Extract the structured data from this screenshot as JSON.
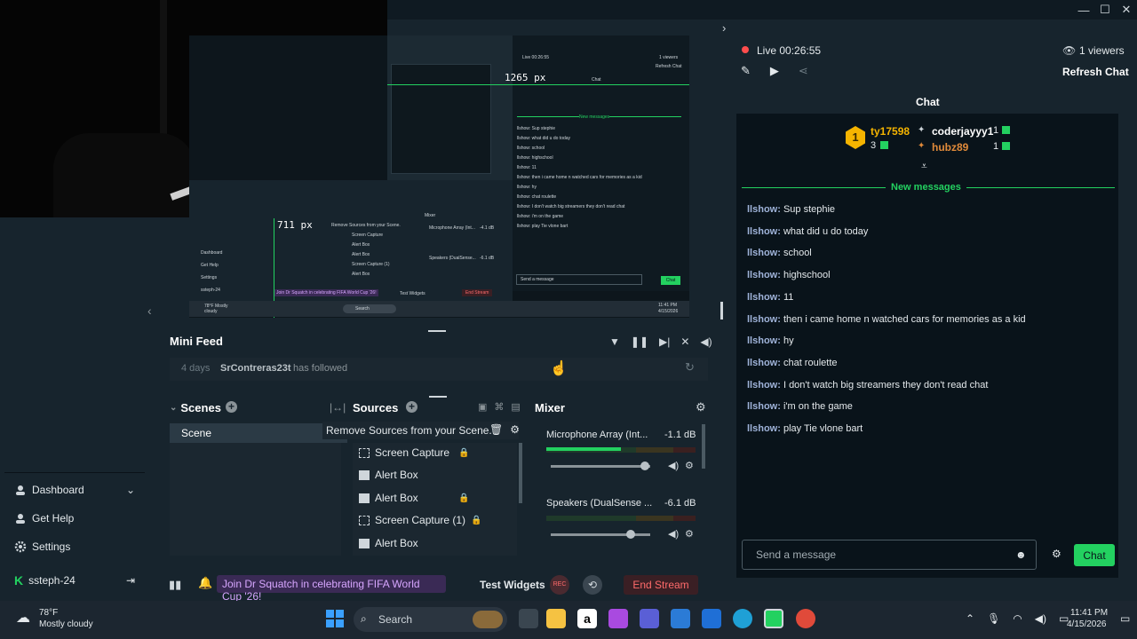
{
  "preview": {
    "width_label": "1265 px",
    "height_label": "711 px",
    "mini_text": {
      "live": "Live 00:26:55",
      "viewers": "1 viewers",
      "refresh": "Refresh Chat",
      "chat": "Chat",
      "new_messages": "New messages",
      "msgs": [
        "llshow: Sup stephie",
        "llshow: what did u do today",
        "llshow: school",
        "llshow: highschool",
        "llshow: 11",
        "llshow: then i came home n watched cars for memories as a kid",
        "llshow: hy",
        "llshow: chat roulette",
        "llshow: I don't watch big streamers they don't read chat",
        "llshow: i'm on the game",
        "llshow: play Tie vlone bart"
      ],
      "send": "Send a message",
      "chat_btn": "Chat",
      "mixer": "Mixer",
      "remove_sources": "Remove Sources from your Scene.",
      "src_items": [
        "Screen Capture",
        "Alert Box",
        "Alert Box",
        "Screen Capture (1)",
        "Alert Box"
      ],
      "mic": "Microphone Array (Int...",
      "mic_db": "-4.1 dB",
      "spk": "Speakers (DualSense...",
      "spk_db": "-6.1 dB",
      "nav": [
        "Dashboard",
        "Get Help",
        "Settings",
        "ssteph-24"
      ],
      "promo": "Join Dr Squatch in celebrating FIFA World Cup '26!",
      "test": "Test Widgets",
      "end": "End Stream",
      "weather": "78°F Mostly cloudy",
      "search": "Search",
      "time": "11:41 PM",
      "date": "4/15/2026"
    }
  },
  "left_nav": {
    "dashboard": "Dashboard",
    "get_help": "Get Help",
    "settings": "Settings",
    "user": "ssteph-24"
  },
  "minifeed": {
    "title": "Mini Feed",
    "time": "4 days",
    "user": "SrContreras23t",
    "action": "has followed"
  },
  "scenes": {
    "title": "Scenes",
    "items": [
      "Scene"
    ]
  },
  "sources": {
    "title": "Sources",
    "tooltip": "Remove Sources from your Scene.",
    "items": [
      "Screen Capture",
      "Alert Box",
      "Alert Box",
      "Screen Capture (1)",
      "Alert Box"
    ]
  },
  "mixer": {
    "title": "Mixer",
    "channels": [
      {
        "name": "Microphone Array (Int...",
        "db": "-1.1 dB",
        "level": 0.5,
        "volume": 0.95
      },
      {
        "name": "Speakers (DualSense ...",
        "db": "-6.1 dB",
        "level": 0.0,
        "volume": 0.8
      }
    ]
  },
  "bottombar": {
    "promo": "Join Dr Squatch in celebrating FIFA World Cup '26!",
    "test_widgets": "Test Widgets",
    "end_stream": "End Stream"
  },
  "chat": {
    "status": "Live 00:26:55",
    "viewers": "1 viewers",
    "refresh": "Refresh Chat",
    "title": "Chat",
    "top_user1": "ty17598",
    "top_user1_count": "3",
    "top_user2": "coderjayyy1",
    "top_user2_count": "1",
    "top_user3": "hubz89",
    "top_user3_count": "1",
    "rank": "1",
    "new_messages": "New messages",
    "messages": [
      {
        "user": "llshow:",
        "text": "Sup stephie"
      },
      {
        "user": "llshow:",
        "text": "what did u do today"
      },
      {
        "user": "llshow:",
        "text": "school"
      },
      {
        "user": "llshow:",
        "text": "highschool"
      },
      {
        "user": "llshow:",
        "text": "11"
      },
      {
        "user": "llshow:",
        "text": "then i came home n watched cars for memories as a kid"
      },
      {
        "user": "llshow:",
        "text": "hy"
      },
      {
        "user": "llshow:",
        "text": "chat roulette"
      },
      {
        "user": "llshow:",
        "text": "I don't watch big streamers they don't read chat"
      },
      {
        "user": "llshow:",
        "text": "i'm on the game"
      },
      {
        "user": "llshow:",
        "text": "play Tie vlone bart"
      }
    ],
    "placeholder": "Send a message",
    "send_label": "Chat"
  },
  "taskbar": {
    "temp": "78°F",
    "weather": "Mostly cloudy",
    "search": "Search",
    "time": "11:41 PM",
    "date": "4/15/2026"
  },
  "colors": {
    "accent": "#23d160",
    "bg": "#17242d",
    "chat_bg": "#09131a",
    "end_stream": "#ff6b6b"
  }
}
